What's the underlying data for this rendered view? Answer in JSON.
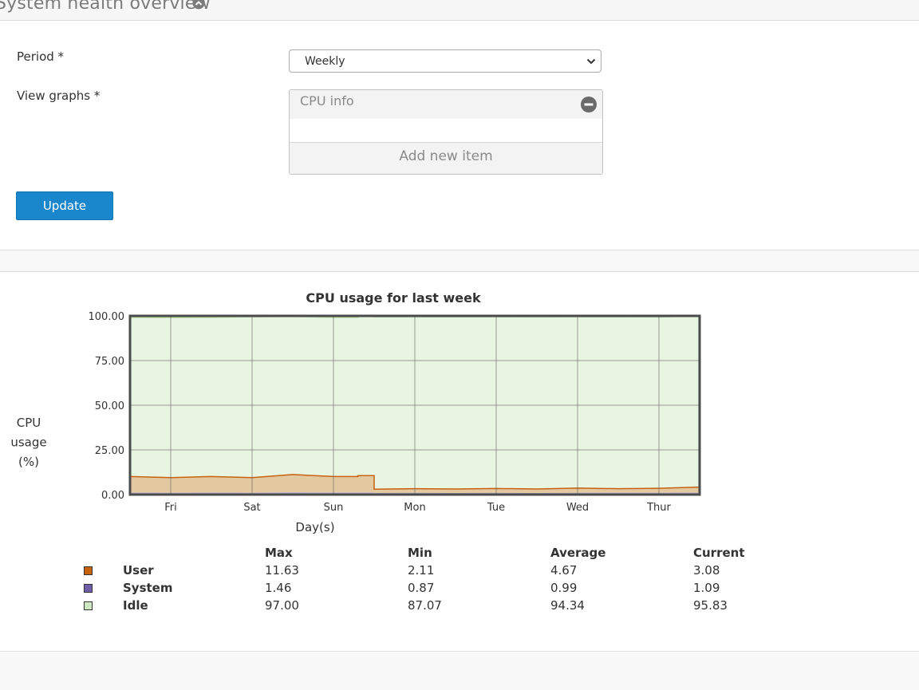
{
  "header": {
    "title": "System health overview"
  },
  "form": {
    "period_label": "Period *",
    "period_value": "Weekly",
    "graphs_label": "View graphs *",
    "graph_items": [
      "CPU info"
    ],
    "add_item_label": "Add new item",
    "update_label": "Update"
  },
  "chart_data": {
    "type": "area",
    "title": "CPU usage for last week",
    "ylabel": "CPU usage (%)",
    "ylabel_lines": [
      "CPU",
      "usage",
      "(%)"
    ],
    "xlabel": "Day(s)",
    "ylim": [
      0,
      100
    ],
    "ytick_labels": [
      "100.00",
      "75.00",
      "50.00",
      "25.00",
      "0.00"
    ],
    "x_tick_labels": [
      "Fri",
      "Sat",
      "Sun",
      "Mon",
      "Tue",
      "Wed",
      "Thur"
    ],
    "x_days": [
      0,
      0.5,
      1,
      1.5,
      2,
      2.5,
      2.8,
      3,
      3.5,
      4,
      4.5,
      5,
      5.5,
      6,
      6.5,
      7
    ],
    "series": [
      {
        "name": "User",
        "color": "#c8620e",
        "values": [
          9,
          8.5,
          9,
          8.5,
          10,
          9,
          9.5,
          2.1,
          2.3,
          2.2,
          2.4,
          2.2,
          2.6,
          2.3,
          2.5,
          3.1
        ]
      },
      {
        "name": "System",
        "color": "#6f5fa8",
        "values": [
          1.1,
          1.0,
          1.1,
          1.0,
          1.2,
          1.1,
          1.1,
          0.9,
          1.0,
          0.9,
          1.0,
          0.9,
          1.0,
          1.0,
          1.0,
          1.1
        ]
      },
      {
        "name": "Idle",
        "color": "#b8e0a8",
        "values": [
          89,
          89.5,
          89,
          90,
          88.5,
          89,
          89,
          96.5,
          96.2,
          96.4,
          96.1,
          96.3,
          95.9,
          96.2,
          95.9,
          95.8
        ]
      }
    ],
    "grid": true
  },
  "legend_table": {
    "headers": [
      "Max",
      "Min",
      "Average",
      "Current"
    ],
    "rows": [
      {
        "name": "User",
        "color": "#c8620e",
        "values": [
          "11.63",
          "2.11",
          "4.67",
          "3.08"
        ]
      },
      {
        "name": "System",
        "color": "#6f5fa8",
        "values": [
          "1.46",
          "0.87",
          "0.99",
          "1.09"
        ]
      },
      {
        "name": "Idle",
        "color": "#cde8c2",
        "values": [
          "97.00",
          "87.07",
          "94.34",
          "95.83"
        ]
      }
    ]
  }
}
